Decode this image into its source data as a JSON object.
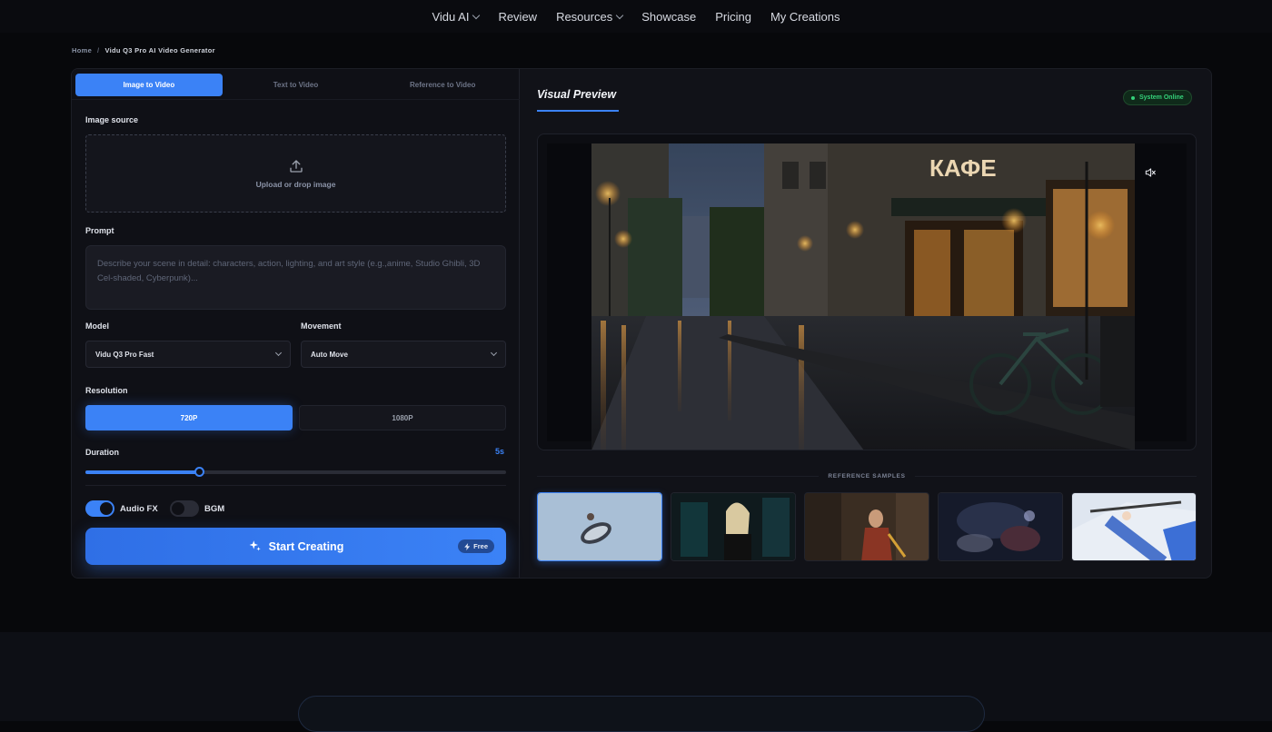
{
  "nav": {
    "items": [
      "Vidu AI",
      "Review",
      "Resources",
      "Showcase",
      "Pricing",
      "My Creations"
    ]
  },
  "breadcrumb": {
    "home": "Home",
    "separator": "/",
    "current": "Vidu Q3 Pro AI Video Generator"
  },
  "tabs": [
    "Image to Video",
    "Text to Video",
    "Reference to Video"
  ],
  "form": {
    "image_source_label": "Image source",
    "upload_text": "Upload or drop image",
    "prompt_label": "Prompt",
    "prompt_placeholder": "Describe your scene in detail: characters, action, lighting, and art style (e.g.,anime, Studio Ghibli, 3D Cel-shaded, Cyberpunk)...",
    "model_label": "Model",
    "model_value": "Vidu Q3 Pro Fast",
    "movement_label": "Movement",
    "movement_value": "Auto Move",
    "resolution_label": "Resolution",
    "resolution_options": [
      "720P",
      "1080P"
    ],
    "resolution_selected": "720P",
    "duration_label": "Duration",
    "duration_value": "5s",
    "duration_fraction": 0.27,
    "audio_fx_label": "Audio FX",
    "audio_fx_on": true,
    "bgm_label": "BGM",
    "bgm_on": false,
    "start_label": "Start Creating",
    "free_badge": "Free"
  },
  "preview": {
    "title": "Visual Preview",
    "status": "System Online",
    "sign_text": "КАФЕ",
    "mute_icon": "speaker-muted-icon",
    "reference_label": "REFERENCE SAMPLES"
  },
  "colors": {
    "accent": "#3b82f6",
    "status_green": "#34d17a",
    "background": "#07080b"
  }
}
